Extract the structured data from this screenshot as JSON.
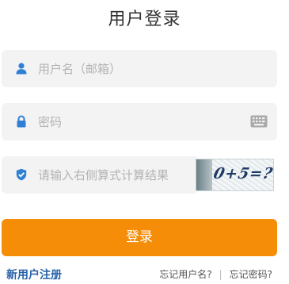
{
  "title": "用户登录",
  "username": {
    "placeholder": "用户名（邮箱）",
    "icon": "user-icon"
  },
  "password": {
    "placeholder": "密码",
    "icon": "lock-icon",
    "keyboard_icon": "keyboard-icon"
  },
  "captcha": {
    "placeholder": "请输入右侧算式计算结果",
    "icon": "shield-check-icon",
    "image_text": "0+5=?"
  },
  "login_button": "登录",
  "register_link": "新用户注册",
  "forgot_username": "忘记用户名?",
  "forgot_password": "忘记密码?",
  "separator": "|",
  "colors": {
    "accent": "#f58d09",
    "icon_blue": "#2f7fd4",
    "link_blue": "#2863a8"
  }
}
